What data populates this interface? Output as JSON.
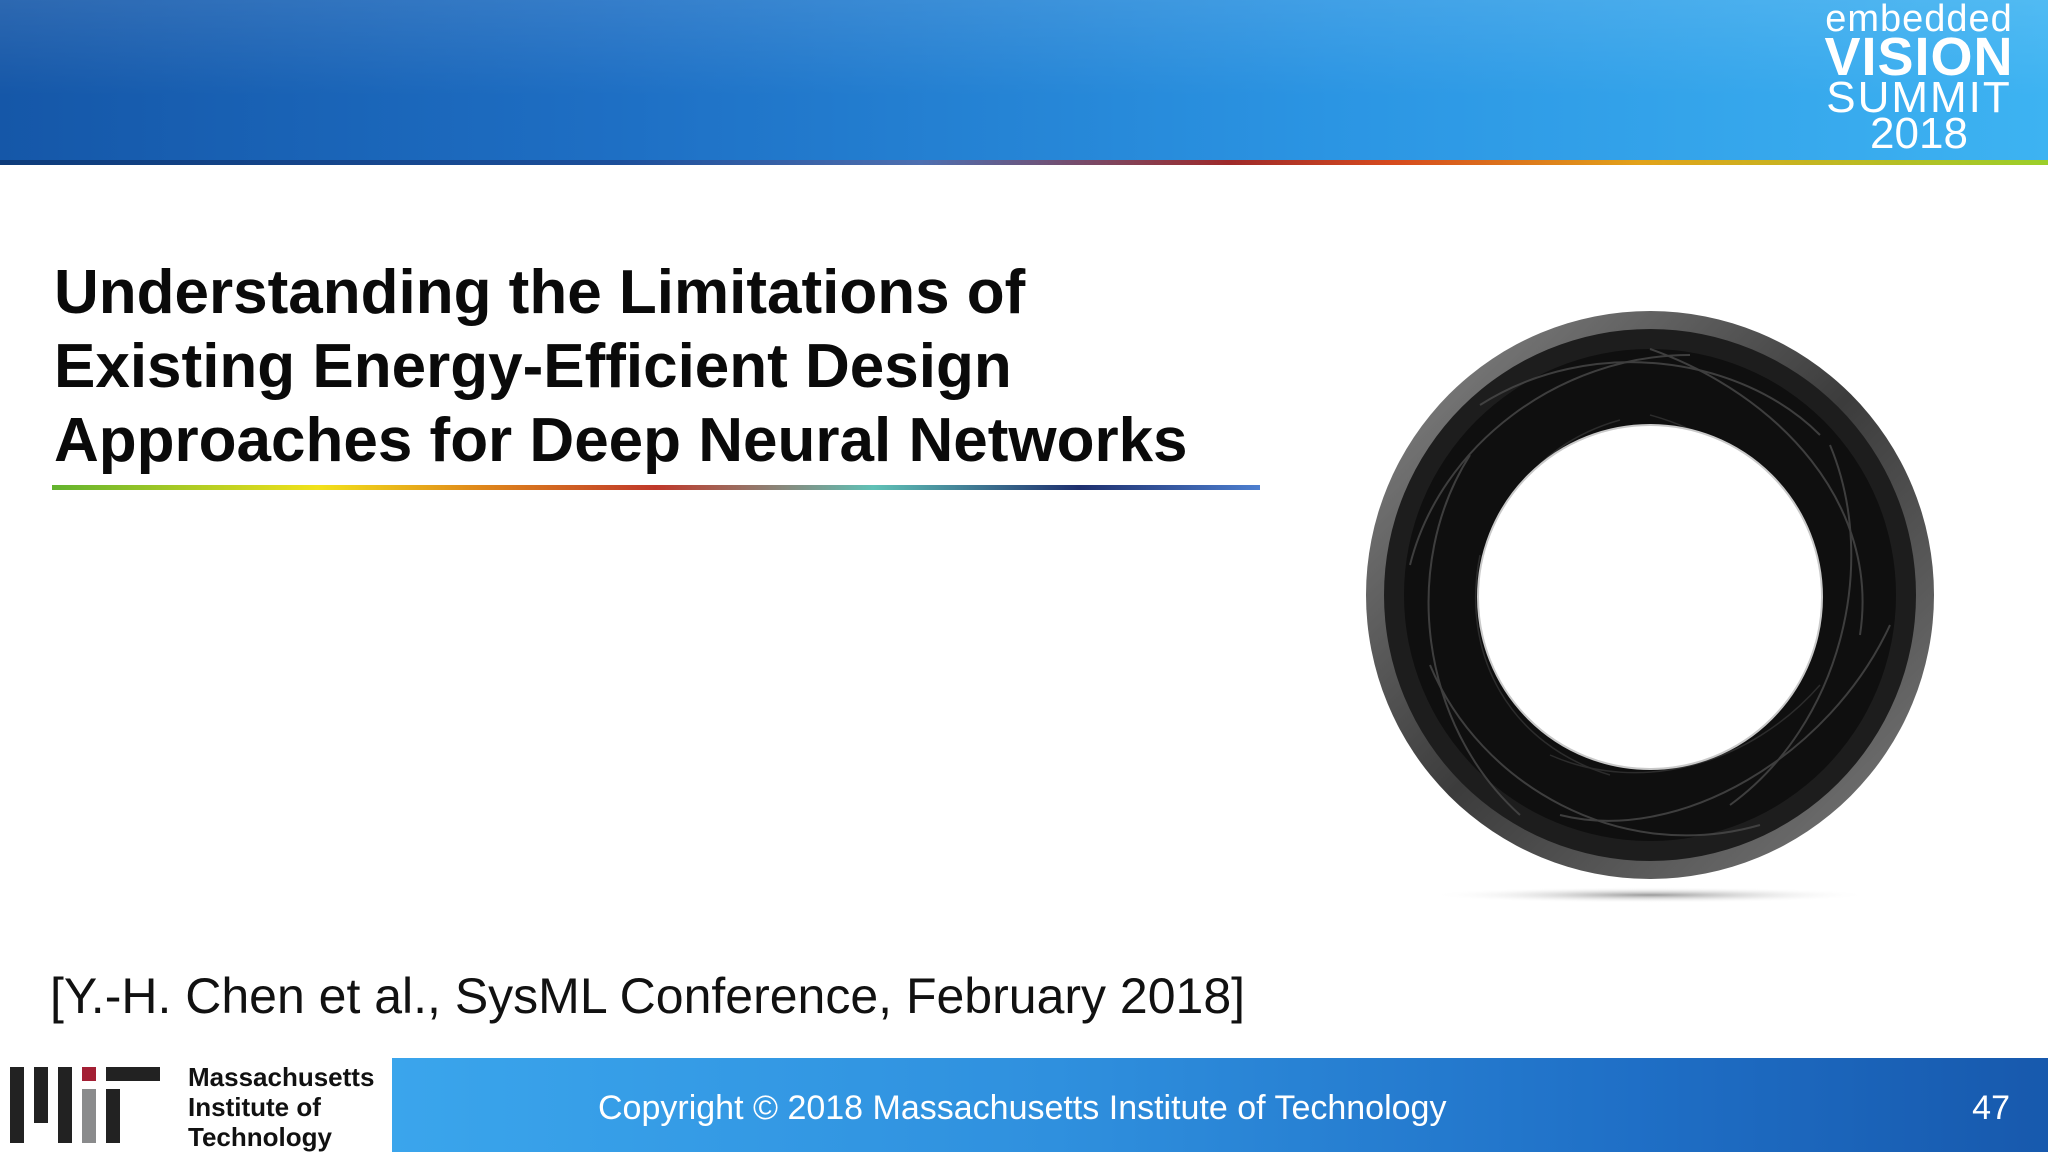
{
  "header": {
    "logo": {
      "line1": "embedded",
      "line2": "VISION",
      "line3": "SUMMIT",
      "line4": "2018"
    }
  },
  "slide": {
    "title_lines": [
      "Understanding the Limitations of",
      "Existing Energy-Efficient Design",
      "Approaches for Deep Neural Networks"
    ],
    "citation": "[Y.-H. Chen et al., SysML Conference, February 2018]"
  },
  "footer": {
    "institution_lines": [
      "Massachusetts",
      "Institute of",
      "Technology"
    ],
    "copyright": "Copyright © 2018 Massachusetts Institute of Technology",
    "page_number": "47"
  }
}
